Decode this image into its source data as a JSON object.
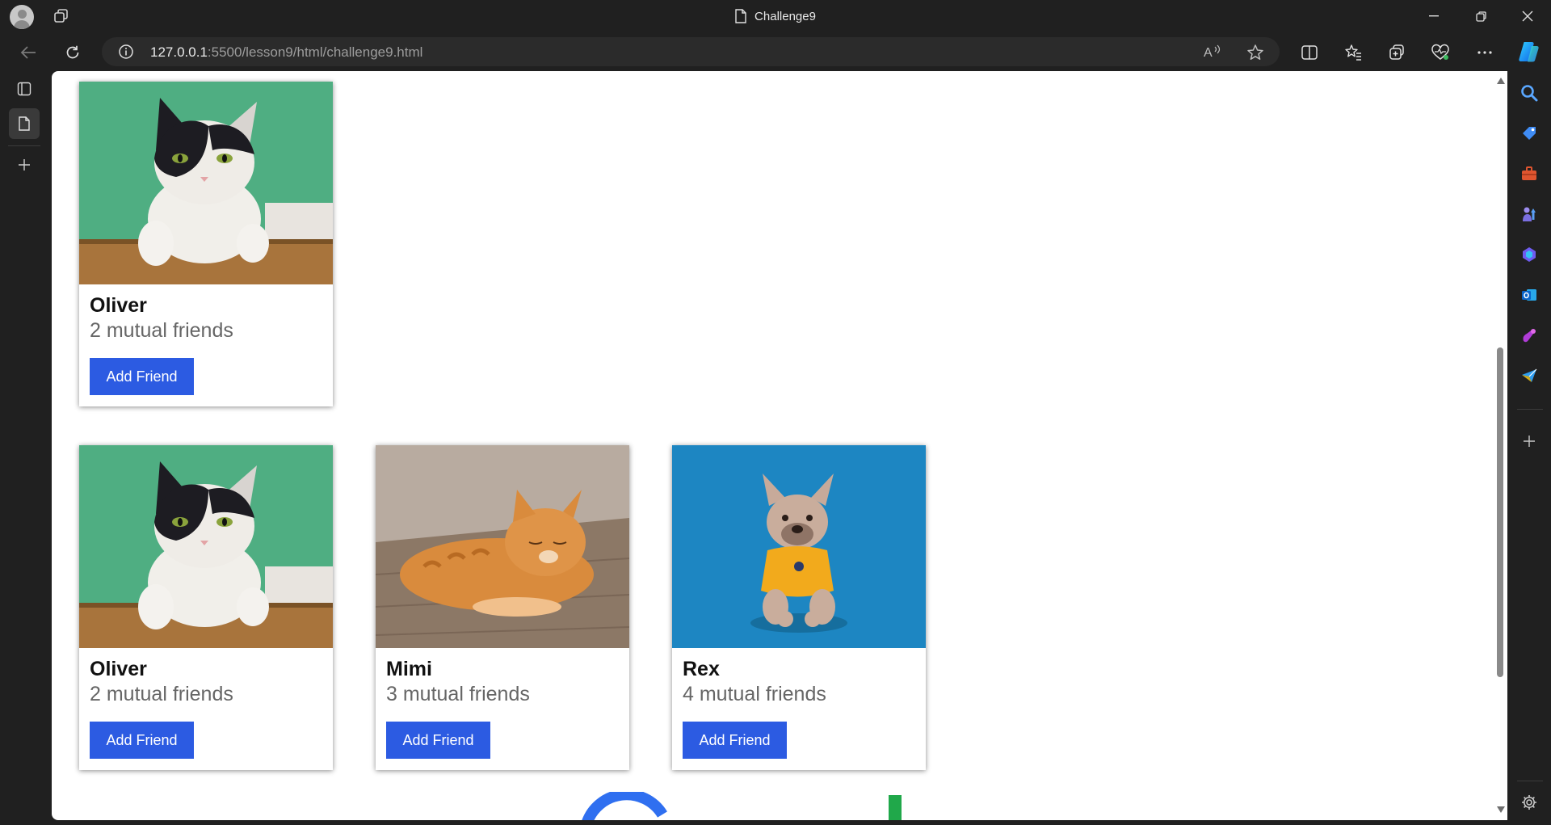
{
  "window": {
    "title": "Challenge9"
  },
  "toolbar": {
    "url_host": "127.0.0.1",
    "url_path": ":5500/lesson9/html/challenge9.html"
  },
  "cards": [
    {
      "name": "Oliver",
      "mutual": "2 mutual friends",
      "button": "Add Friend",
      "photo": "cat-black-white-on-green"
    },
    {
      "name": "Oliver",
      "mutual": "2 mutual friends",
      "button": "Add Friend",
      "photo": "cat-black-white-on-green"
    },
    {
      "name": "Mimi",
      "mutual": "3 mutual friends",
      "button": "Add Friend",
      "photo": "orange-tabby-cat-on-floor"
    },
    {
      "name": "Rex",
      "mutual": "4 mutual friends",
      "button": "Add Friend",
      "photo": "french-bulldog-in-yellow-shirt-on-blue"
    }
  ],
  "colors": {
    "button": "#2c5be2",
    "chrome": "#202020",
    "page": "#ffffff"
  },
  "scroll_position_fraction": 0.42
}
